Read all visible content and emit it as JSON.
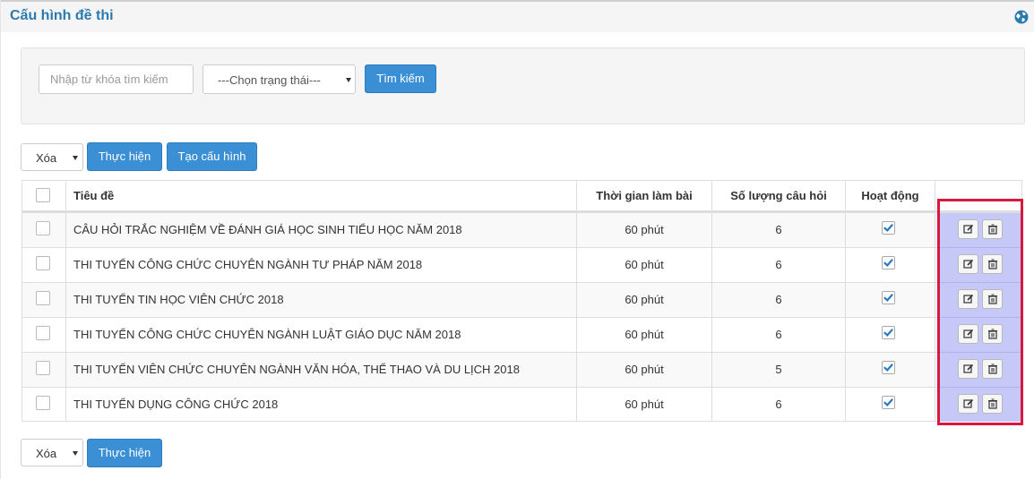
{
  "header": {
    "title": "Cấu hình đề thi",
    "globe_icon": "globe-icon"
  },
  "search": {
    "keyword_placeholder": "Nhập từ khóa tìm kiếm",
    "status_selected": "---Chọn trạng thái---",
    "search_button": "Tìm kiếm"
  },
  "actions_top": {
    "selected": "Xóa",
    "execute": "Thực hiện",
    "create": "Tạo cấu hình"
  },
  "actions_bottom": {
    "selected": "Xóa",
    "execute": "Thực hiện"
  },
  "table": {
    "columns": [
      "",
      "Tiêu đề",
      "Thời gian làm bài",
      "Số lượng câu hỏi",
      "Hoạt động",
      ""
    ],
    "rows": [
      {
        "title": "CÂU HỎI TRẮC NGHIỆM VỀ ĐÁNH GIÁ HỌC SINH TIỂU HỌC NĂM 2018",
        "time": "60 phút",
        "count": "6",
        "active": true
      },
      {
        "title": "THI TUYỂN CÔNG CHỨC CHUYÊN NGÀNH TƯ PHÁP NĂM 2018",
        "time": "60 phút",
        "count": "6",
        "active": true
      },
      {
        "title": "THI TUYỂN TIN HỌC VIÊN CHỨC 2018",
        "time": "60 phút",
        "count": "6",
        "active": true
      },
      {
        "title": "THI TUYỂN CÔNG CHỨC CHUYÊN NGÀNH LUẬT GIÁO DỤC NĂM 2018",
        "time": "60 phút",
        "count": "6",
        "active": true
      },
      {
        "title": "THI TUYỂN VIÊN CHỨC CHUYÊN NGÀNH VĂN HÓA, THỂ THAO VÀ DU LỊCH 2018",
        "time": "60 phút",
        "count": "5",
        "active": true
      },
      {
        "title": "THI TUYỂN DỤNG CÔNG CHỨC 2018",
        "time": "60 phút",
        "count": "6",
        "active": true
      }
    ],
    "row_icons": {
      "edit": "edit-icon",
      "delete": "trash-icon"
    }
  },
  "colors": {
    "primary": "#3a8fd5",
    "title": "#2a7ab0",
    "highlight": "#c6c9f7",
    "annotation": "#d8183f"
  }
}
